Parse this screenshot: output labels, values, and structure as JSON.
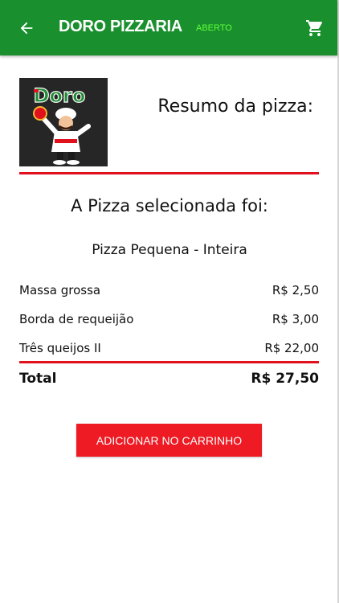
{
  "header": {
    "title": "DORO PIZZARIA",
    "status": "ABERTO",
    "back_icon": "arrow-left-icon",
    "cart_icon": "shopping-cart-icon"
  },
  "logo": {
    "text": "Doro"
  },
  "summary": {
    "heading": "Resumo da pizza:",
    "selected_heading": "A Pizza selecionada foi:",
    "pizza_name": "Pizza Pequena - Inteira",
    "items": [
      {
        "name": "Massa grossa",
        "price": "R$ 2,50"
      },
      {
        "name": "Borda de requeijão",
        "price": "R$ 3,00"
      },
      {
        "name": "Três queijos II",
        "price": "R$ 22,00"
      }
    ],
    "total_label": "Total",
    "total_value": "R$ 27,50"
  },
  "actions": {
    "add_to_cart": "ADICIONAR NO CARRINHO"
  },
  "colors": {
    "appbar": "#1a8f2e",
    "status": "#5fff3a",
    "accent_red": "#e0101c",
    "button": "#ee1b24"
  }
}
